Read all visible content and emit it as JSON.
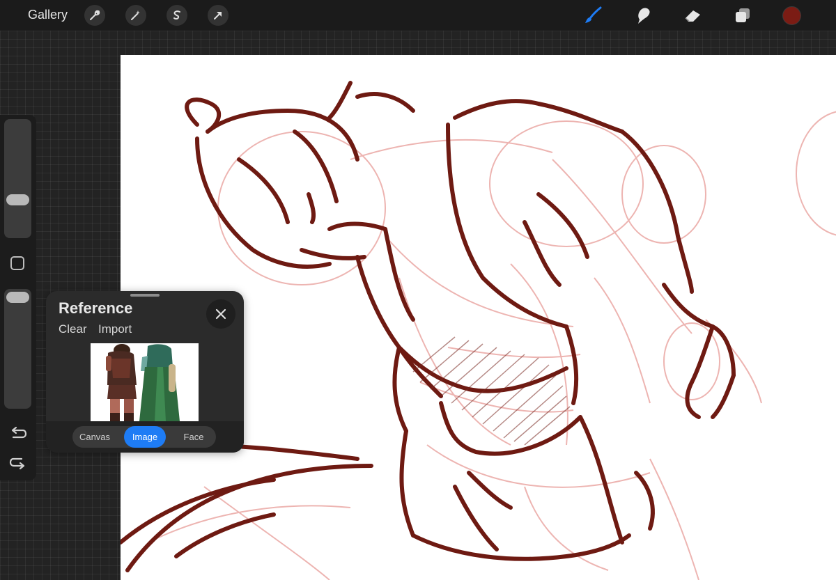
{
  "topbar": {
    "gallery_label": "Gallery",
    "left_tools": [
      "wrench-icon",
      "magic-wand-icon",
      "selection-icon",
      "transform-arrow-icon"
    ],
    "right_tools": [
      "brush-icon",
      "smudge-icon",
      "eraser-icon",
      "layers-icon"
    ],
    "active_tool": "brush-icon",
    "current_color": "#7b1c14",
    "accent_color": "#1e7cf5"
  },
  "sidebar": {
    "brush_size_level": 0.65,
    "opacity_level": 0.0,
    "icons": [
      "modify-square-icon",
      "undo-icon",
      "redo-icon"
    ]
  },
  "reference": {
    "title": "Reference",
    "clear_label": "Clear",
    "import_label": "Import",
    "tabs": [
      {
        "label": "Canvas",
        "active": false
      },
      {
        "label": "Image",
        "active": true
      },
      {
        "label": "Face",
        "active": false
      }
    ]
  },
  "canvas": {
    "stroke_color": "#6e1a12",
    "sketch_color": "#e8a3a0"
  }
}
